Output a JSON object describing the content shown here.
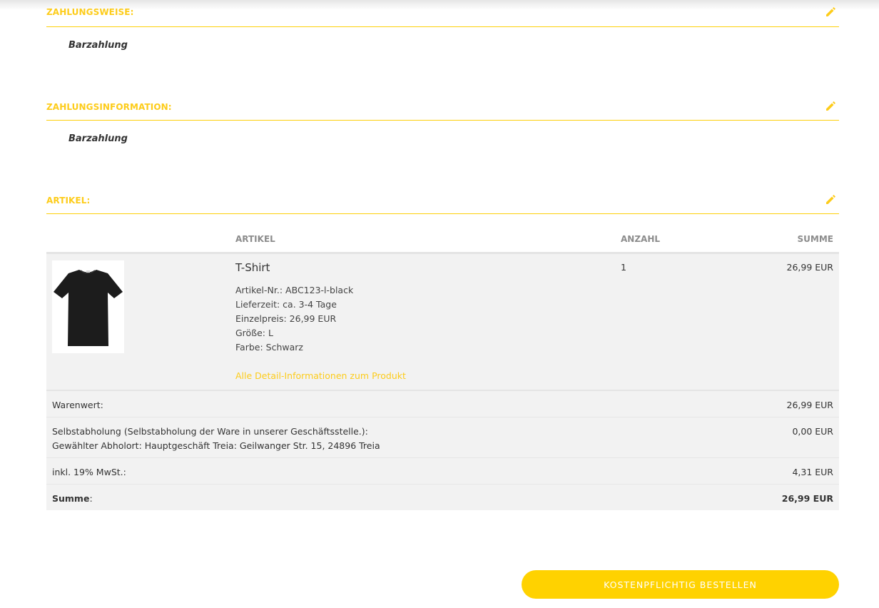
{
  "sections": {
    "payment_method": {
      "title": "ZAHLUNGSWEISE:",
      "value": "Barzahlung"
    },
    "payment_info": {
      "title": "ZAHLUNGSINFORMATION:",
      "value": "Barzahlung"
    },
    "items": {
      "title": "ARTIKEL:"
    }
  },
  "table": {
    "headers": {
      "article": "ARTIKEL",
      "quantity": "ANZAHL",
      "total": "SUMME"
    },
    "item": {
      "name": "T-Shirt",
      "details": [
        "Artikel-Nr.: ABC123-l-black",
        "Lieferzeit: ca. 3-4 Tage",
        "Einzelpreis: 26,99 EUR",
        "Größe: L",
        "Farbe: Schwarz"
      ],
      "detail_link": "Alle Detail-Informationen zum Produkt",
      "quantity": "1",
      "sum": "26,99 EUR",
      "image_icon": "tshirt-image"
    }
  },
  "totals": {
    "goods_value": {
      "label": "Warenwert:",
      "value": "26,99 EUR"
    },
    "shipping": {
      "label_line1": "Selbstabholung (Selbstabholung der Ware in unserer Geschäftsstelle.):",
      "label_line2": "Gewählter Abholort: Hauptgeschäft Treia: Geilwanger Str. 15, 24896 Treia",
      "value": "0,00 EUR"
    },
    "vat": {
      "label": "inkl. 19% MwSt.:",
      "value": "4,31 EUR"
    },
    "sum": {
      "label": "Summe",
      "label_suffix": ":",
      "value": "26,99 EUR"
    }
  },
  "order_button": "KOSTENPFLICHTIG BESTELLEN",
  "colors": {
    "accent": "#fdcc1a",
    "button": "#ffd200",
    "row_bg": "#f2f2f2"
  }
}
